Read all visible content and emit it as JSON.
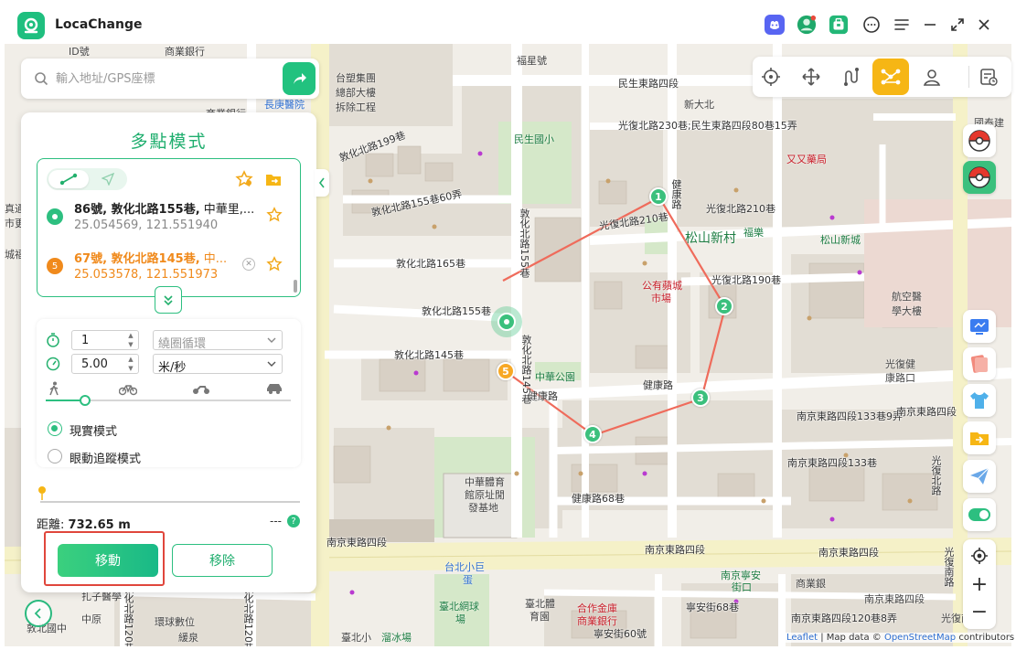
{
  "app": {
    "title": "LocaChange"
  },
  "search": {
    "placeholder": "輸入地址/GPS座標"
  },
  "panel": {
    "title": "多點模式",
    "waypoints": [
      {
        "number": "",
        "address_bold": "86號, 敦化北路155巷,",
        "address_rest": " 中華里,...",
        "coords": "25.054569, 121.551940"
      },
      {
        "number": "5",
        "address_bold": "67號, 敦化北路145巷,",
        "address_rest": " 中...",
        "coords": "25.053578, 121.551973"
      }
    ],
    "loop_count": "1",
    "loop_mode": "繞圈循環",
    "speed": "5.00",
    "speed_unit": "米/秒",
    "speed_level": 0.16,
    "modes": [
      {
        "label": "現實模式",
        "selected": true
      },
      {
        "label": "眼動追蹤模式",
        "selected": false
      }
    ],
    "distance_label": "距離:",
    "distance_value": "732.65 m",
    "time_value": "---",
    "help_glyph": "?",
    "move_button": "移動",
    "remove_button": "移除"
  },
  "map": {
    "attribution_leaflet": "Leaflet",
    "attribution_mid": " | Map data © ",
    "attribution_osm": "OpenStreetMap",
    "attribution_end": " contributors",
    "route_markers": [
      "1",
      "2",
      "3",
      "4",
      "5"
    ],
    "zoom_in": "+",
    "zoom_out": "−",
    "labels": {
      "street_1": "敦化北路199巷",
      "street_2": "敦化北路155巷60弄",
      "street_3": "敦化北路165巷",
      "street_4": "敦化北路155巷",
      "street_5": "敦化北路145巷",
      "street_6": "民生東路四段",
      "street_7": "光復北路230巷;民生東路四段80巷15弄",
      "street_8": "光復北路210巷",
      "street_9": "光復北路210巷",
      "street_10": "光復北路190巷",
      "street_11": "健康路",
      "street_12": "健康路",
      "street_13": "南京東路四段133巷9弄",
      "street_14": "南京東路四段133巷",
      "street_15": "健康路68巷",
      "street_16": "南京東路四段",
      "street_17": "南京東路四段",
      "street_18": "南京東路四段",
      "street_19": "南京東路四段",
      "street_20": "寧安街68巷",
      "street_21": "寧安街60號",
      "street_22": "敦化北路155巷",
      "street_23": "南京東路四段120巷8弄",
      "street_24": "健康路",
      "street_25": "光復北路",
      "street_26": "敦化北路145巷",
      "street_27": "敦化北路120巷",
      "street_28": "敦化北路120巷",
      "street_29": "光復南路",
      "poi_1": "台塑集團",
      "poi_2": "總部大樓",
      "poi_3": "拆除工程",
      "poi_4": "民生國小",
      "poi_5": "松山新村",
      "poi_6": "公有蘋城",
      "poi_7": "市場",
      "poi_8": "中華公園",
      "poi_9": "航空醫",
      "poi_10": "學大樓",
      "poi_11": "又又藥局",
      "poi_12": "國泰建",
      "poi_13": "中華體育",
      "poi_14": "館原址閒",
      "poi_15": "發基地",
      "poi_16": "臺北體",
      "poi_17": "育園",
      "poi_18": "台北小巨",
      "poi_19": "蛋",
      "poi_20": "臺北網球",
      "poi_21": "場",
      "poi_22": "合作金庫",
      "poi_23": "商業銀行",
      "poi_24": "臺北小",
      "poi_25": "溜冰場",
      "poi_26": "敦北國中",
      "poi_27": "光復健",
      "poi_28": "康路口",
      "poi_29": "松山新城",
      "poi_30": "福樂",
      "poi_31": "中原",
      "poi_32": "緩泉",
      "poi_33": "環球數位",
      "poi_34": "扎子醫學",
      "poi_35": "長庚醫院",
      "poi_36": "商業銀行",
      "poi_37": "福星號",
      "poi_38": "新大北",
      "poi_39": "商業銀行",
      "poi_40": "真通",
      "poi_41": "市更",
      "poi_42": "城福",
      "poi_43": "合金",
      "poi_44": "金庫",
      "poi_45": "南京寧安",
      "poi_46": "街口",
      "poi_47": "商業銀",
      "poi_48": "ID號",
      "poi_49": "南京東路四段",
      "poi_50": "光復南路"
    }
  },
  "colors": {
    "accent": "#2dbf80",
    "active_tool": "#f6b615",
    "route": "#ef6b5b",
    "highlight": "#e0463c"
  }
}
